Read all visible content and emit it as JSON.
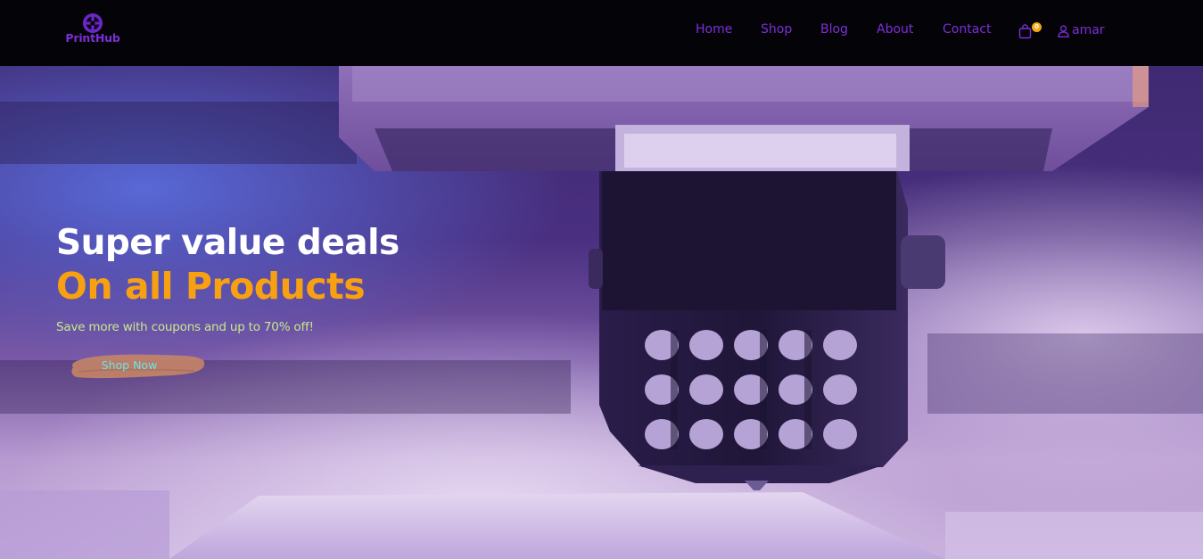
{
  "brand": {
    "name": "PrintHub",
    "color": "#7b2fd6"
  },
  "nav": {
    "items": [
      {
        "label": "Home"
      },
      {
        "label": "Shop"
      },
      {
        "label": "Blog"
      },
      {
        "label": "About"
      },
      {
        "label": "Contact"
      }
    ],
    "color": "#7c2fd8"
  },
  "cart": {
    "icon": "shopping-bag-icon",
    "count": "0"
  },
  "user": {
    "icon": "user-icon",
    "name": "amar"
  },
  "hero": {
    "title": "Super value deals",
    "subtitle": "On all Products",
    "text": "Save more with coupons and up to 70% off!",
    "button_label": "Shop Now",
    "colors": {
      "title": "#ffffff",
      "subtitle": "#f7a112",
      "text": "#c7e98b",
      "button_text": "#68e4e6",
      "button_brush": "#c38367"
    }
  }
}
